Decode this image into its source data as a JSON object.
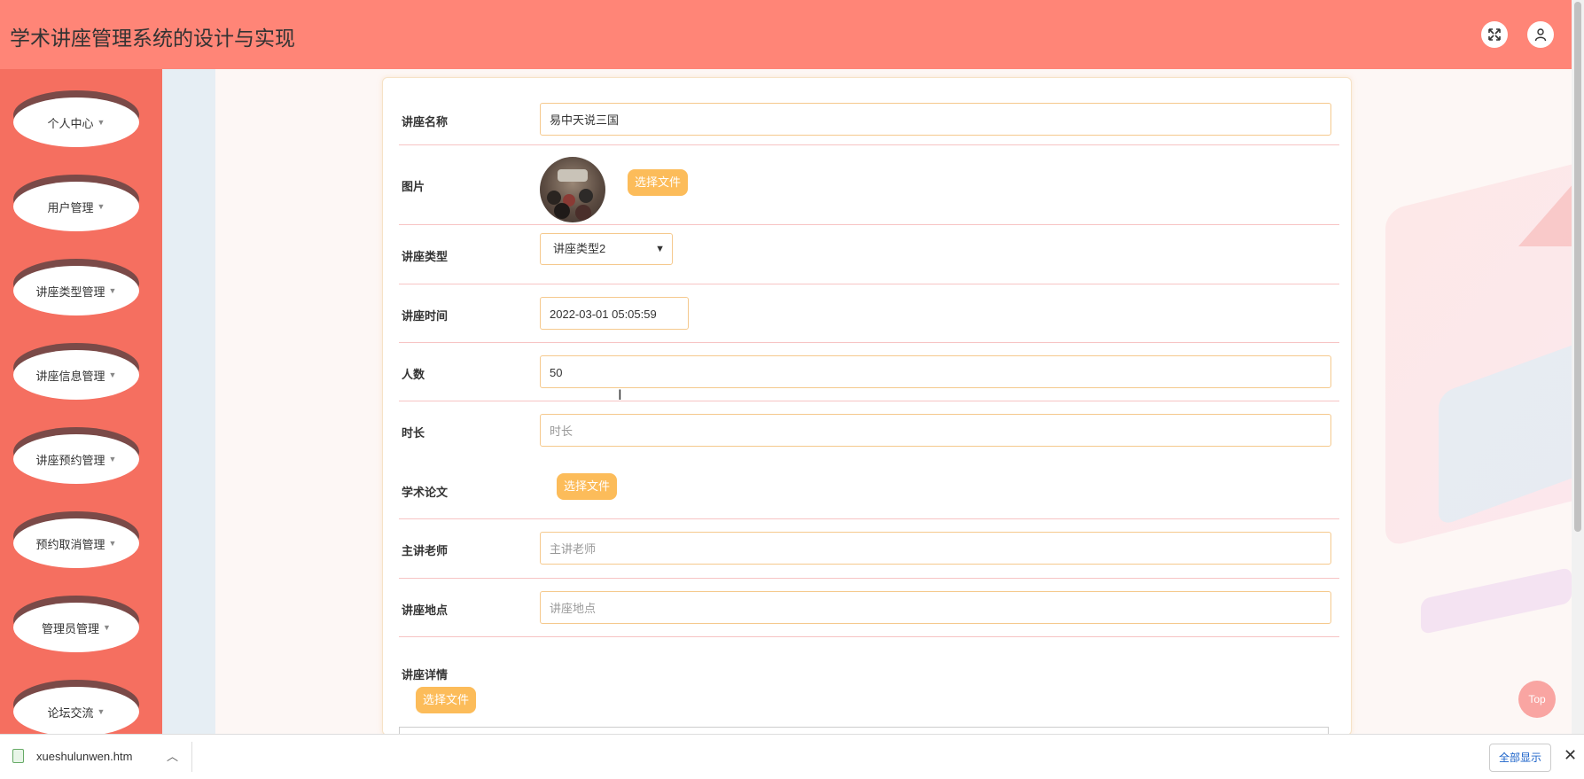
{
  "header": {
    "title": "学术讲座管理系统的设计与实现"
  },
  "sidebar": {
    "items": [
      {
        "label": "个人中心"
      },
      {
        "label": "用户管理"
      },
      {
        "label": "讲座类型管理"
      },
      {
        "label": "讲座信息管理"
      },
      {
        "label": "讲座预约管理"
      },
      {
        "label": "预约取消管理"
      },
      {
        "label": "管理员管理"
      },
      {
        "label": "论坛交流"
      }
    ]
  },
  "form": {
    "name_label": "讲座名称",
    "name_value": "易中天说三国",
    "image_label": "图片",
    "image_button": "选择文件",
    "type_label": "讲座类型",
    "type_value": "讲座类型2",
    "time_label": "讲座时间",
    "time_value": "2022-03-01 05:05:59",
    "count_label": "人数",
    "count_value": "50",
    "duration_label": "时长",
    "duration_placeholder": "时长",
    "paper_label": "学术论文",
    "paper_button": "选择文件",
    "teacher_label": "主讲老师",
    "teacher_placeholder": "主讲老师",
    "place_label": "讲座地点",
    "place_placeholder": "讲座地点",
    "detail_label": "讲座详情",
    "detail_button": "选择文件"
  },
  "top_button": "Top",
  "download_bar": {
    "filename": "xueshulunwen.htm",
    "show_all": "全部显示"
  },
  "colors": {
    "header": "#ff8577",
    "sidebar": "#f56f60",
    "accent_button": "#fcbc5a",
    "input_border": "#f5c98d"
  }
}
